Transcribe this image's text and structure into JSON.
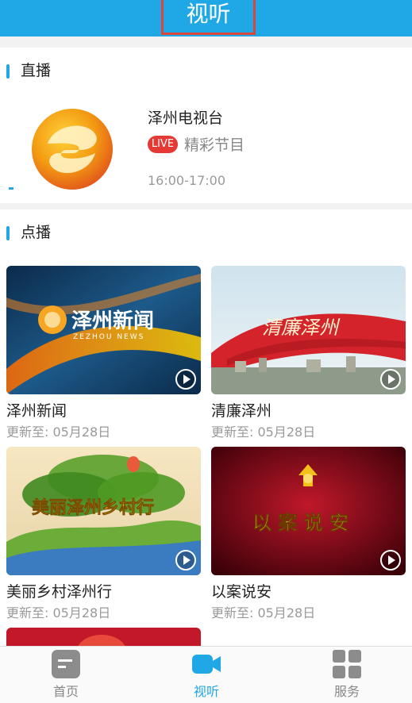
{
  "header": {
    "title": "视听"
  },
  "live": {
    "section_title": "直播",
    "channel_name": "泽州电视台",
    "badge": "LIVE",
    "program": "精彩节目",
    "time": "16:00-17:00"
  },
  "vod": {
    "section_title": "点播",
    "items": [
      {
        "title": "泽州新闻",
        "update": "更新至:   05月28日",
        "thumb_text": "泽州新闻",
        "thumb_subtext": "ZEZHOU NEWS"
      },
      {
        "title": "清廉泽州",
        "update": "更新至:   05月28日",
        "thumb_text": "清廉泽州"
      },
      {
        "title": "美丽乡村泽州行",
        "update": "更新至:   05月28日",
        "thumb_text": "美丽泽州乡村行"
      },
      {
        "title": "以案说安",
        "update": "更新至:   05月28日",
        "thumb_text": "以 案 说 安"
      }
    ]
  },
  "tabbar": {
    "items": [
      {
        "label": "首页",
        "icon": "home-icon",
        "active": false
      },
      {
        "label": "视听",
        "icon": "video-camera-icon",
        "active": true
      },
      {
        "label": "服务",
        "icon": "grid-icon",
        "active": false
      }
    ]
  },
  "colors": {
    "accent": "#1fa7e6",
    "live_badge": "#e53935"
  }
}
